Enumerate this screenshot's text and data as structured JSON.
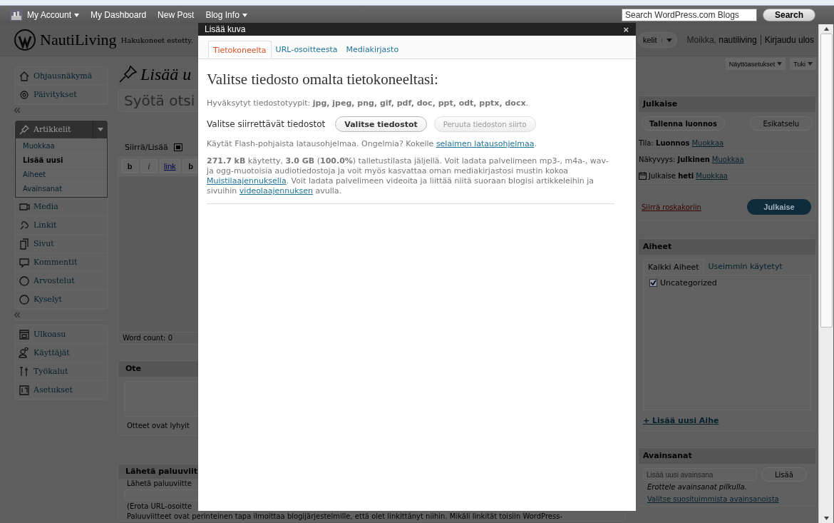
{
  "admin_bar": {
    "items": [
      {
        "label": "My Account",
        "dropdown": true
      },
      {
        "label": "My Dashboard",
        "dropdown": false
      },
      {
        "label": "New Post",
        "dropdown": false
      },
      {
        "label": "Blog Info",
        "dropdown": true
      }
    ],
    "search": {
      "placeholder": "Search WordPress.com Blogs"
    },
    "search_button": "Search"
  },
  "header": {
    "site_title": "NautiLiving",
    "tagline": "Hakukoneet estetty.",
    "favorites": "kelit",
    "greeting": "Moikka,",
    "username": "nautiliving",
    "logout": "Kirjaudu ulos"
  },
  "screen_tabs": [
    {
      "label": "Näyttöasetukset"
    },
    {
      "label": "Tuki"
    }
  ],
  "sidebar": {
    "groups": [
      [
        {
          "label": "Ohjausnäkymä"
        },
        {
          "label": "Päivitykset"
        }
      ],
      [
        {
          "label": "Artikkelit",
          "expanded": true,
          "children": [
            {
              "label": "Muokkaa",
              "selected": false
            },
            {
              "label": "Lisää uusi",
              "selected": true
            },
            {
              "label": "Aiheet",
              "selected": false
            },
            {
              "label": "Avainsanat",
              "selected": false
            }
          ]
        },
        {
          "label": "Media"
        },
        {
          "label": "Linkit"
        },
        {
          "label": "Sivut"
        },
        {
          "label": "Kommentit"
        },
        {
          "label": "Arvostelut"
        },
        {
          "label": "Kyselyt"
        }
      ],
      [
        {
          "label": "Ulkoasu"
        },
        {
          "label": "Käyttäjät"
        },
        {
          "label": "Työkalut"
        },
        {
          "label": "Asetukset"
        }
      ]
    ]
  },
  "editor": {
    "title": "Lisää u",
    "title_placeholder": "Syötä otsi",
    "upload_label": "Siirrä/Lisää",
    "toolbar": [
      "b",
      "i",
      "link",
      "b"
    ],
    "word_count": "Word count: 0"
  },
  "excerpt": {
    "title": "Ote",
    "note": "Otteet ovat lyhyit"
  },
  "trackbacks": {
    "title": "Lähetä paluuviit",
    "label": "Lähetä paluuviitte",
    "note": "(Erota URL-osoitte",
    "description": "Paluuviitteet ovat perinteinen tapa ilmoittaa blogijärjestelmille, että olet linkittänyt niihin. Mikäli linkität toisiin WordPress-"
  },
  "publish": {
    "title": "Julkaise",
    "save_button": "Tallenna luonnos",
    "preview_button": "Esikatselu",
    "rows": [
      {
        "kind": "status",
        "label": "Tila:",
        "value": "Luonnos",
        "link": "Muokkaa"
      },
      {
        "kind": "status",
        "label": "Näkyvyys:",
        "value": "Julkinen",
        "link": "Muokkaa"
      },
      {
        "kind": "schedule",
        "label": "Julkaise",
        "value": "heti",
        "link": "Muokkaa"
      }
    ],
    "trash_link": "Siirrä roskakoriin",
    "publish_button": "Julkaise"
  },
  "categories": {
    "title": "Aiheet",
    "tabs": [
      {
        "label": "Kaikki Aiheet",
        "selected": true
      },
      {
        "label": "Useimmin käytetyt",
        "selected": false
      }
    ],
    "items": [
      {
        "label": "Uncategorized",
        "checked": true
      }
    ],
    "add_link": "+ Lisää uusi Aihe"
  },
  "tags": {
    "title": "Avainsanat",
    "placeholder": "Lisää uusi avainsana",
    "add_button": "Lisää",
    "hint": "Erottele avainsanat pilkulla.",
    "link": "Valitse suosituimmista avainsanoista"
  },
  "modal": {
    "title": "Lisää kuva",
    "close": "×",
    "tabs": [
      {
        "label": "Tietokoneelta",
        "selected": true
      },
      {
        "label": "URL-osoitteesta",
        "selected": false
      },
      {
        "label": "Mediakirjasto",
        "selected": false
      }
    ],
    "heading": "Valitse tiedosto omalta tietokoneeltasi:",
    "allowed": "Hyväksytyt tiedostotyypit: **jpg, jpeg, png, gif, pdf, doc, ppt, odt, pptx, docx**.",
    "select_label": "Valitse siirrettävät tiedostot",
    "select_button": {
      "label": "Valitse tiedostot",
      "disabled": false
    },
    "cancel_button": {
      "label": "Peruuta tiedoston siirto",
      "disabled": true
    },
    "flash_note": [
      {
        "kind": "text",
        "text": "Käytät Flash-pohjaista latausohjelmaa. Ongelmia? Kokeile "
      },
      {
        "kind": "link",
        "text": "selaimen latausohjelmaa"
      },
      {
        "kind": "text",
        "text": "."
      }
    ],
    "storage_note": [
      {
        "kind": "text",
        "text": "**271.7 kB** käytetty, **3.0 GB** (**100.0%**) talletustilasta jäljellä. Voit ladata palvelimeen mp3-, m4a-, wav- ja ogg-muotoisia audiotiedostoja ja voit myös kasvattaa oman mediakirjastosi mustin kokoa "
      },
      {
        "kind": "link",
        "text": "Muistilaajennuksella"
      },
      {
        "kind": "text",
        "text": ". Voit ladata palvelimeen videoita ja liittää niitä suoraan blogisi artikkeleihin ja sivuihin "
      },
      {
        "kind": "link",
        "text": "videolaajennuksen"
      },
      {
        "kind": "text",
        "text": " avulla."
      }
    ]
  }
}
